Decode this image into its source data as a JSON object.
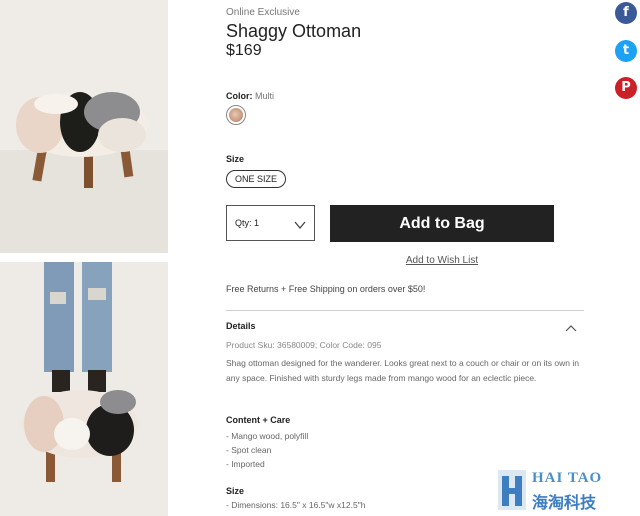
{
  "product": {
    "eyebrow": "Online Exclusive",
    "title": "Shaggy Ottoman",
    "price": "$169"
  },
  "color": {
    "label": "Color:",
    "value": "Multi",
    "swatch_color": "#c99a80"
  },
  "size": {
    "label": "Size",
    "option": "ONE SIZE"
  },
  "purchase": {
    "qty_label": "Qty: 1",
    "add_to_bag": "Add to Bag",
    "wish_list": "Add to Wish List",
    "button_color": "#222222"
  },
  "shipping_text": "Free Returns + Free Shipping on orders over $50!",
  "details": {
    "heading": "Details",
    "sku": "Product Sku: 36580009; Color Code: 095",
    "description": "Shag ottoman designed for the wanderer. Looks great next to a couch or chair or on its own in any space. Finished with sturdy legs made from mango wood for an eclectic piece.",
    "care_heading": "Content + Care",
    "care_items": [
      "- Mango wood, polyfill",
      "- Spot clean",
      "- Imported"
    ],
    "size_heading": "Size",
    "dimensions": "- Dimensions: 16.5\" x 16.5\"w x12.5\"h"
  },
  "social": {
    "facebook_glyph": "f",
    "twitter_glyph": "t",
    "pinterest_glyph": "P",
    "icons": [
      "facebook-icon",
      "twitter-icon",
      "pinterest-icon"
    ]
  },
  "watermark": {
    "latin": "HAI TAO",
    "cjk": "海淘科技"
  }
}
